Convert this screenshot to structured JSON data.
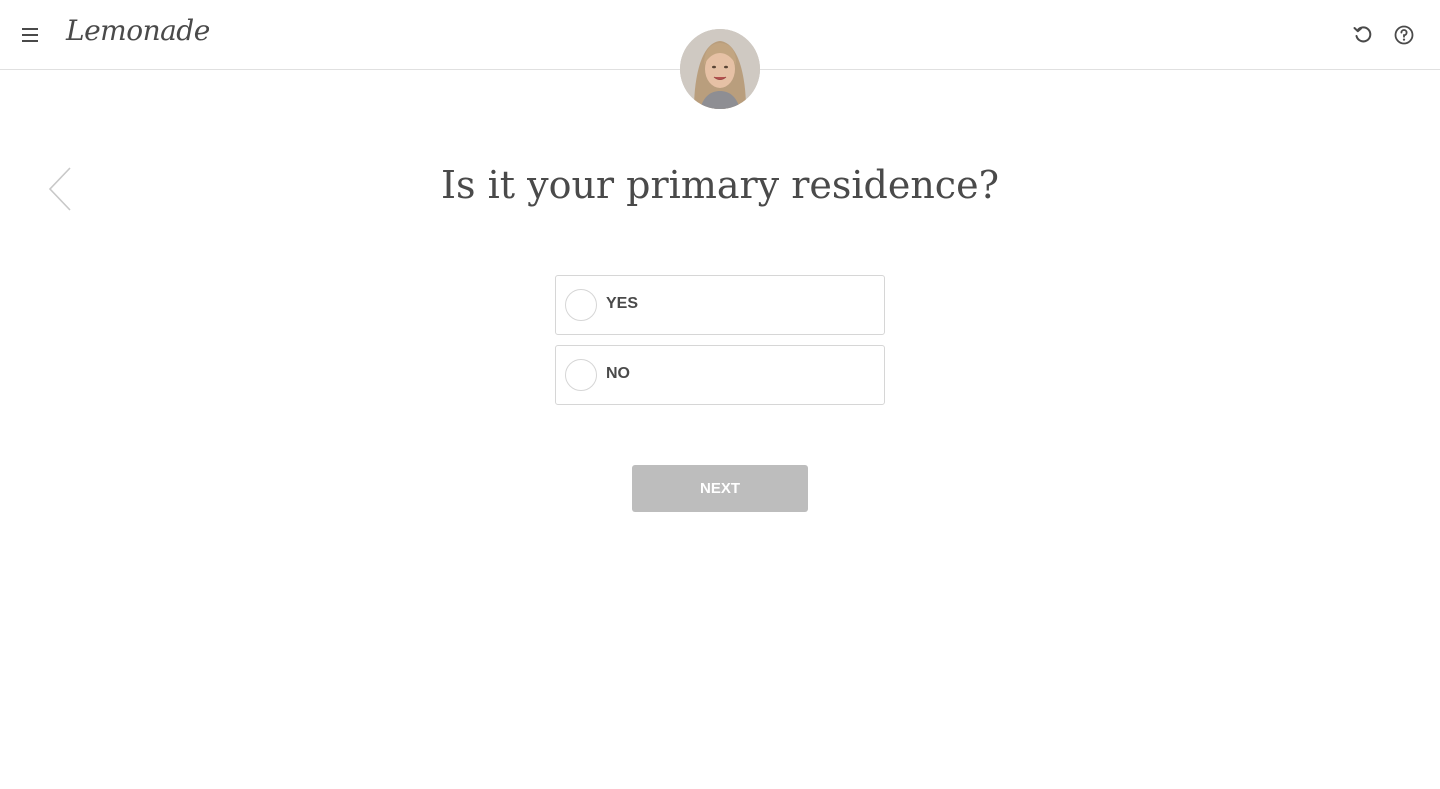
{
  "header": {
    "logo_text": "Lemonade",
    "menu_icon": "hamburger-menu-icon",
    "restart_icon": "restart-icon",
    "help_icon": "help-icon"
  },
  "assistant": {
    "avatar": "assistant-avatar"
  },
  "navigation": {
    "back_icon": "chevron-left-icon"
  },
  "question": {
    "text": "Is it your primary residence?"
  },
  "options": [
    {
      "label": "YES",
      "selected": false
    },
    {
      "label": "NO",
      "selected": false
    }
  ],
  "next_button": {
    "label": "NEXT",
    "enabled": false
  },
  "colors": {
    "text": "#4a4a4a",
    "border": "#d6d6d6",
    "button_disabled": "#bdbdbd",
    "divider": "#e0e0e0"
  }
}
